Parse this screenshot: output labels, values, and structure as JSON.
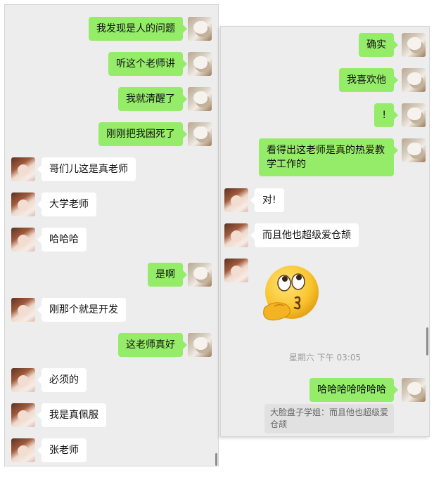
{
  "left_chat": {
    "messages": [
      {
        "from": "me",
        "text": "我发现是人的问题"
      },
      {
        "from": "me",
        "text": "听这个老师讲"
      },
      {
        "from": "me",
        "text": "我就清醒了"
      },
      {
        "from": "me",
        "text": "刚刚把我困死了"
      },
      {
        "from": "friend",
        "text": "哥们儿这是真老师"
      },
      {
        "from": "friend",
        "text": "大学老师"
      },
      {
        "from": "friend",
        "text": "哈哈哈"
      },
      {
        "from": "me",
        "text": "是啊"
      },
      {
        "from": "friend",
        "text": "刚那个就是开发"
      },
      {
        "from": "me",
        "text": "这老师真好"
      },
      {
        "from": "friend",
        "text": "必须的"
      },
      {
        "from": "friend",
        "text": "我是真佩服"
      },
      {
        "from": "friend",
        "text": "张老师"
      }
    ]
  },
  "right_chat": {
    "messages": [
      {
        "from": "me",
        "text": "确实"
      },
      {
        "from": "me",
        "text": "我喜欢他"
      },
      {
        "from": "me",
        "text": "!"
      },
      {
        "from": "me",
        "text": "看得出这老师是真的热爱教学工作的"
      },
      {
        "from": "friend",
        "text": "对!"
      },
      {
        "from": "friend",
        "text": "而且他也超级爱仓颉"
      },
      {
        "from": "friend",
        "sticker": "thinking-face-emoji"
      }
    ],
    "timestamp": "星期六 下午 03:05",
    "last_message": {
      "from": "me",
      "text": "哈哈哈哈哈哈哈"
    },
    "quote": "大脸盘子学姐：而且他也超级爱仓颉"
  },
  "colors": {
    "my_bubble": "#95ec69",
    "friend_bubble": "#ffffff",
    "background": "#ededed"
  }
}
